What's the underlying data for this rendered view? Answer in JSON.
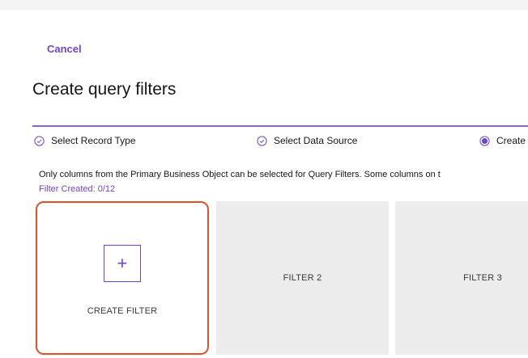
{
  "cancel_label": "Cancel",
  "page_title": "Create query filters",
  "steps": [
    {
      "label": "Select Record Type",
      "status": "complete",
      "icon": "checkmark-outline-icon"
    },
    {
      "label": "Select Data Source",
      "status": "complete",
      "icon": "checkmark-outline-icon"
    },
    {
      "label": "Create",
      "status": "current",
      "icon": "current-step-icon"
    }
  ],
  "info_text": "Only columns from the Primary Business Object can be selected for Query Filters. Some columns on t",
  "filter_counter": "Filter Created: 0/12",
  "tiles": {
    "create_label": "CREATE FILTER",
    "create_icon": "plus-icon",
    "filter_2_label": "FILTER 2",
    "filter_3_label": "FILTER 3"
  },
  "colors": {
    "accent": "#6e45c8",
    "selected_border": "#e0512b",
    "tile_background": "#ececec"
  }
}
